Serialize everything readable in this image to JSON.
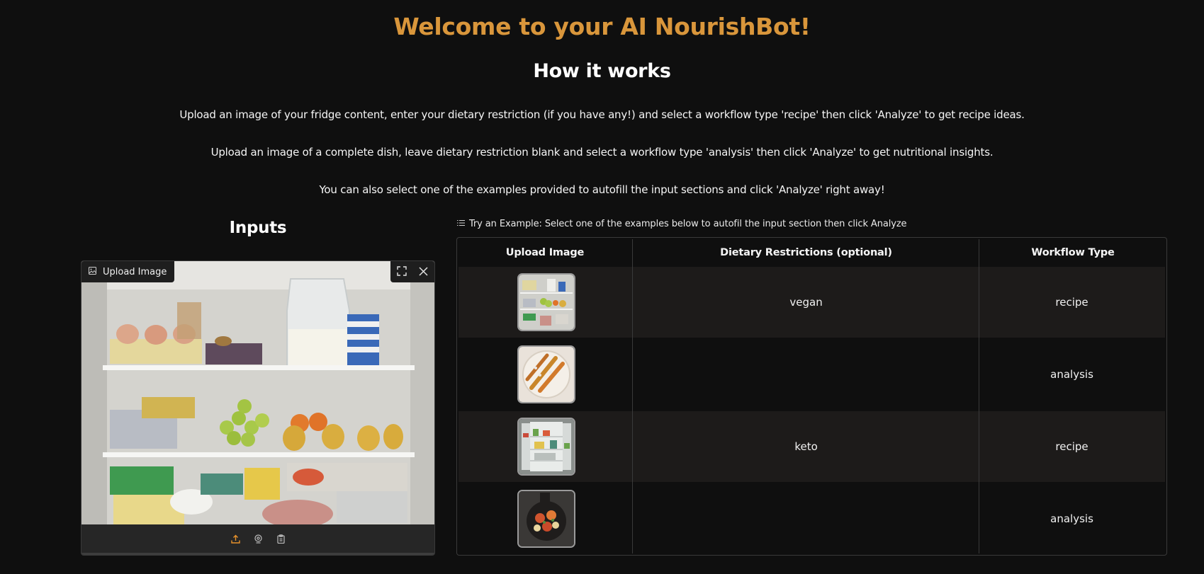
{
  "header": {
    "title": "Welcome to your AI NourishBot!",
    "subtitle": "How it works",
    "paragraphs": [
      "Upload an image of your fridge content, enter your dietary restriction (if you have any!) and select a workflow type 'recipe' then click 'Analyze' to get recipe ideas.",
      "Upload an image of a complete dish, leave dietary restriction blank and select a workflow type 'analysis' then click 'Analyze' to get nutritional insights.",
      "You can also select one of the examples provided to autofill the input sections and click 'Analyze' right away!"
    ]
  },
  "inputs": {
    "heading": "Inputs",
    "upload": {
      "label": "Upload Image",
      "icons": [
        "image-icon",
        "fullscreen-icon",
        "close-icon",
        "upload-icon",
        "webcam-icon",
        "clipboard-icon"
      ],
      "accent_color": "#e8922b"
    }
  },
  "examples": {
    "label": "Try an Example: Select one of the examples below to autofil the input section then click Analyze",
    "columns": [
      "Upload Image",
      "Dietary Restrictions (optional)",
      "Workflow Type"
    ],
    "rows": [
      {
        "image": "fridge-shelves-thumbnail",
        "dietary": "vegan",
        "workflow": "recipe"
      },
      {
        "image": "skewers-dish-thumbnail",
        "dietary": "",
        "workflow": "analysis"
      },
      {
        "image": "open-fridge-thumbnail",
        "dietary": "keto",
        "workflow": "recipe"
      },
      {
        "image": "skillet-dish-thumbnail",
        "dietary": "",
        "workflow": "analysis"
      }
    ]
  },
  "colors": {
    "background": "#0f0f0f",
    "title": "#d9963b",
    "panel": "#242424",
    "row_alt": "#1d1b1a",
    "border": "#3a3a3a"
  }
}
